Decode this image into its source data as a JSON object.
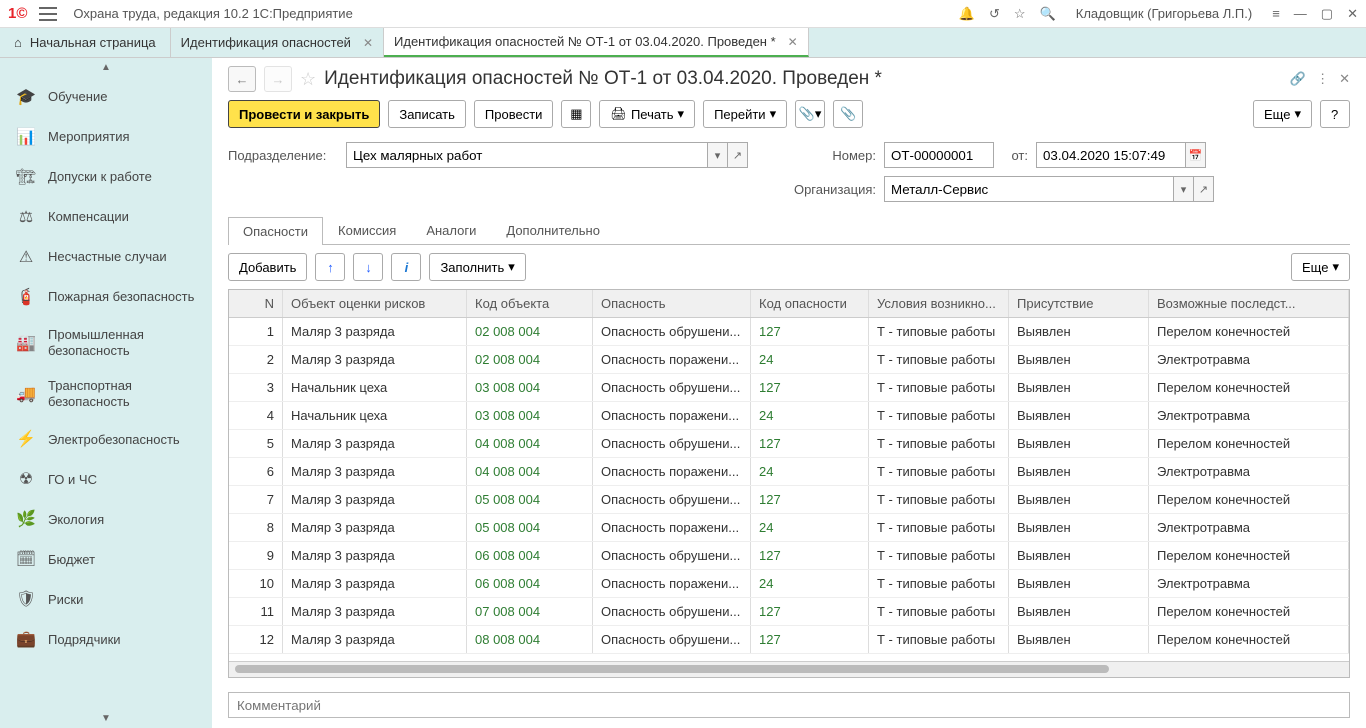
{
  "chrome": {
    "title": "Охрана труда, редакция 10.2 1С:Предприятие",
    "user": "Кладовщик (Григорьева Л.П.)"
  },
  "tabs": {
    "home": "Начальная страница",
    "items": [
      {
        "label": "Идентификация опасностей"
      },
      {
        "label": "Идентификация опасностей № ОТ-1 от 03.04.2020. Проведен *",
        "active": true
      }
    ]
  },
  "sidebar": [
    {
      "icon": "🎓",
      "label": "Обучение"
    },
    {
      "icon": "📊",
      "label": "Мероприятия"
    },
    {
      "icon": "🏗",
      "label": "Допуски к работе"
    },
    {
      "icon": "⚖",
      "label": "Компенсации"
    },
    {
      "icon": "⚠",
      "label": "Несчастные случаи"
    },
    {
      "icon": "🧯",
      "label": "Пожарная безопасность"
    },
    {
      "icon": "🏭",
      "label": "Промышленная безопасность"
    },
    {
      "icon": "🚚",
      "label": "Транспортная безопасность"
    },
    {
      "icon": "⚡",
      "label": "Электробезопасность"
    },
    {
      "icon": "☢",
      "label": "ГО и ЧС"
    },
    {
      "icon": "🌿",
      "label": "Экология"
    },
    {
      "icon": "🗓",
      "label": "Бюджет"
    },
    {
      "icon": "🛡",
      "label": "Риски"
    },
    {
      "icon": "💼",
      "label": "Подрядчики"
    }
  ],
  "doc": {
    "title": "Идентификация опасностей № ОТ-1 от 03.04.2020. Проведен *"
  },
  "toolbar": {
    "post_close": "Провести и закрыть",
    "save": "Записать",
    "post": "Провести",
    "print": "Печать",
    "goto": "Перейти",
    "more": "Еще"
  },
  "form": {
    "subdivision_label": "Подразделение:",
    "subdivision_value": "Цех малярных работ",
    "number_label": "Номер:",
    "number_value": "ОТ-00000001",
    "from_label": "от:",
    "date_value": "03.04.2020 15:07:49",
    "org_label": "Организация:",
    "org_value": "Металл-Сервис"
  },
  "inner_tabs": [
    "Опасности",
    "Комиссия",
    "Аналоги",
    "Дополнительно"
  ],
  "grid_toolbar": {
    "add": "Добавить",
    "fill": "Заполнить",
    "more": "Еще"
  },
  "columns": {
    "n": "N",
    "obj": "Объект оценки рисков",
    "code": "Код объекта",
    "hazard": "Опасность",
    "hcode": "Код опасности",
    "cond": "Условия возникно...",
    "presence": "Присутствие",
    "cons": "Возможные последст..."
  },
  "rows": [
    {
      "n": "1",
      "obj": "Маляр 3 разряда",
      "code": "02 008 004",
      "hazard": "Опасность обрушени...",
      "hcode": "127",
      "cond": "Т - типовые работы",
      "presence": "Выявлен",
      "cons": "Перелом конечностей"
    },
    {
      "n": "2",
      "obj": "Маляр 3 разряда",
      "code": "02 008 004",
      "hazard": "Опасность поражени...",
      "hcode": "24",
      "cond": "Т - типовые работы",
      "presence": "Выявлен",
      "cons": "Электротравма"
    },
    {
      "n": "3",
      "obj": "Начальник цеха",
      "code": "03 008 004",
      "hazard": "Опасность обрушени...",
      "hcode": "127",
      "cond": "Т - типовые работы",
      "presence": "Выявлен",
      "cons": "Перелом конечностей"
    },
    {
      "n": "4",
      "obj": "Начальник цеха",
      "code": "03 008 004",
      "hazard": "Опасность поражени...",
      "hcode": "24",
      "cond": "Т - типовые работы",
      "presence": "Выявлен",
      "cons": "Электротравма"
    },
    {
      "n": "5",
      "obj": "Маляр 3 разряда",
      "code": "04 008 004",
      "hazard": "Опасность обрушени...",
      "hcode": "127",
      "cond": "Т - типовые работы",
      "presence": "Выявлен",
      "cons": "Перелом конечностей"
    },
    {
      "n": "6",
      "obj": "Маляр 3 разряда",
      "code": "04 008 004",
      "hazard": "Опасность поражени...",
      "hcode": "24",
      "cond": "Т - типовые работы",
      "presence": "Выявлен",
      "cons": "Электротравма"
    },
    {
      "n": "7",
      "obj": "Маляр 3 разряда",
      "code": "05 008 004",
      "hazard": "Опасность обрушени...",
      "hcode": "127",
      "cond": "Т - типовые работы",
      "presence": "Выявлен",
      "cons": "Перелом конечностей"
    },
    {
      "n": "8",
      "obj": "Маляр 3 разряда",
      "code": "05 008 004",
      "hazard": "Опасность поражени...",
      "hcode": "24",
      "cond": "Т - типовые работы",
      "presence": "Выявлен",
      "cons": "Электротравма"
    },
    {
      "n": "9",
      "obj": "Маляр 3 разряда",
      "code": "06 008 004",
      "hazard": "Опасность обрушени...",
      "hcode": "127",
      "cond": "Т - типовые работы",
      "presence": "Выявлен",
      "cons": "Перелом конечностей"
    },
    {
      "n": "10",
      "obj": "Маляр 3 разряда",
      "code": "06 008 004",
      "hazard": "Опасность поражени...",
      "hcode": "24",
      "cond": "Т - типовые работы",
      "presence": "Выявлен",
      "cons": "Электротравма"
    },
    {
      "n": "11",
      "obj": "Маляр 3 разряда",
      "code": "07 008 004",
      "hazard": "Опасность обрушени...",
      "hcode": "127",
      "cond": "Т - типовые работы",
      "presence": "Выявлен",
      "cons": "Перелом конечностей"
    },
    {
      "n": "12",
      "obj": "Маляр 3 разряда",
      "code": "08 008 004",
      "hazard": "Опасность обрушени...",
      "hcode": "127",
      "cond": "Т - типовые работы",
      "presence": "Выявлен",
      "cons": "Перелом конечностей"
    }
  ],
  "comment_placeholder": "Комментарий",
  "help": "?"
}
